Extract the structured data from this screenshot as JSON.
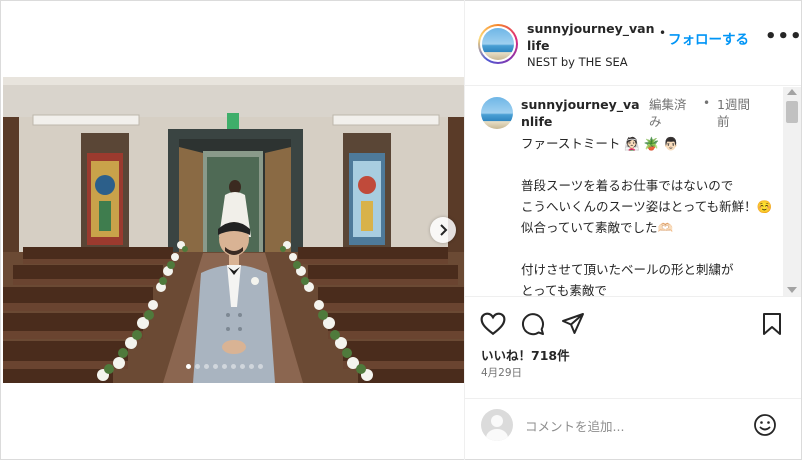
{
  "post": {
    "username": "sunnyjourney_vanlife",
    "follow_separator": "•",
    "follow_label": "フォローする",
    "more_label": "•••",
    "location": "NEST by THE SEA"
  },
  "caption": {
    "username": "sunnyjourney_vanlife",
    "edited": "編集済み",
    "separator": "•",
    "time": "1週間前",
    "text": "ファーストミート 👰🏻 🪴 👨🏻\n\n普段スーツを着るお仕事ではないので\nこうへいくんのスーツ姿はとっても新鮮！☺️\n似合っていて素敵でした🫶🏻\n\n付けさせて頂いたベールの形と刺繍が\nとっても素敵で"
  },
  "carousel": {
    "slide_count": 9,
    "active_index": 0
  },
  "actions": {
    "like_icon": "heart-icon",
    "comment_icon": "comment-icon",
    "share_icon": "share-icon",
    "save_icon": "bookmark-icon"
  },
  "stats": {
    "likes": "いいね！718件",
    "date": "4月29日"
  },
  "comment_input": {
    "placeholder": "コメントを追加..."
  },
  "colors": {
    "accent": "#0095f6",
    "text": "#262626",
    "muted": "#737373"
  }
}
